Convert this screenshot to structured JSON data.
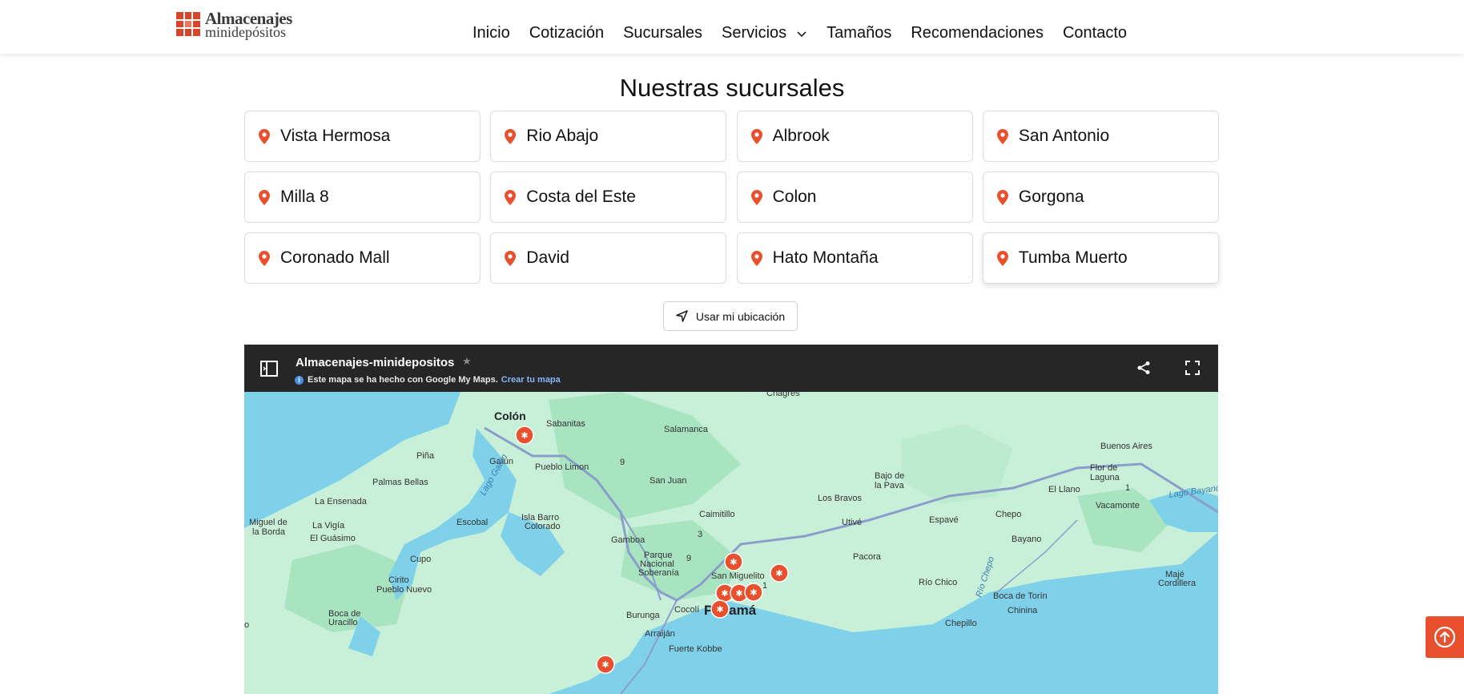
{
  "brand": {
    "line1": "Almacenajes",
    "line2": "minidepósitos"
  },
  "nav": {
    "items": [
      "Inicio",
      "Cotización",
      "Sucursales",
      "Servicios",
      "Tamaños",
      "Recomendaciones",
      "Contacto"
    ]
  },
  "section": {
    "title": "Nuestras sucursales"
  },
  "branches": [
    "Vista Hermosa",
    "Rio Abajo",
    "Albrook",
    "San Antonio",
    "Milla 8",
    "Costa del Este",
    "Colon",
    "Gorgona",
    "Coronado Mall",
    "David",
    "Hato Montaña",
    "Tumba Muerto"
  ],
  "location_button": {
    "label": "Usar mi ubicación"
  },
  "map": {
    "title": "Almacenajes-minidepositos",
    "info_text": "Este mapa se ha hecho con Google My Maps.",
    "create_link": "Crear tu mapa",
    "labels": {
      "colon": "Colón",
      "sabanitas": "Sabanitas",
      "salamanca": "Salamanca",
      "chagres": "Chagres",
      "pina": "Piña",
      "gatun": "Gatún",
      "pueblo_limon": "Pueblo Limon",
      "r9": "9",
      "san_juan": "San Juan",
      "palmas_bellas": "Palmas Bellas",
      "lago_gatun": "Lago Gatún",
      "la_ensenada": "La Ensenada",
      "miguel1": "Miguel de",
      "miguel2": "la Borda",
      "la_vigia": "La Vigía",
      "el_guasimo": "El Guásimo",
      "escobal": "Escobal",
      "isla_barro1": "Isla Barro",
      "isla_barro2": "Colorado",
      "caimitillo": "Caimitillo",
      "r3": "3",
      "gamboa": "Gamboa",
      "parque1": "Parque",
      "parque2": "Nacional",
      "parque3": "Soberanía",
      "r9b": "9",
      "cupo": "Cupo",
      "cirito": "Cirito",
      "pueblo_nuevo": "Pueblo Nuevo",
      "boca1": "Boca de",
      "boca2": "Uracillo",
      "burunga": "Burunga",
      "arraijan": "Arraiján",
      "fuerte_kobbe": "Fuerte Kobbe",
      "cocoli": "Cocolí",
      "panama": "Panamá",
      "san_miguelito": "San Miguelito",
      "r1": "1",
      "los_bravos": "Los Bravos",
      "bajo1": "Bajo de",
      "bajo2": "la Pava",
      "utive": "Utivé",
      "espave": "Espavé",
      "pacora": "Pacora",
      "chepo": "Chepo",
      "el_llano": "El Llano",
      "r1b": "1",
      "buenos_aires": "Buenos Aires",
      "flor1": "Flor de",
      "flor2": "Laguna",
      "lago_bayano": "Lago Bayano",
      "vacamonte": "Vacamonte",
      "bayano": "Bayano",
      "rio_chico": "Río Chico",
      "rio_chepo": "Río Chepo",
      "boca_torin": "Boca de Torín",
      "chinina": "Chinina",
      "chepillo": "Chepillo",
      "maje1": "Majé",
      "maje2": "Cordillera",
      "o_label": "o"
    }
  },
  "colors": {
    "accent": "#e8502e",
    "pin": "#e8502e",
    "map_bar": "#262626",
    "land": "#c8f0d8",
    "water": "#7fd1ea"
  },
  "icons": [
    "map-pin-icon",
    "chevron-down-icon",
    "navigation-arrow-icon",
    "sidebar-toggle-icon",
    "share-icon",
    "fullscreen-icon",
    "arrow-up-circle-icon",
    "storage-marker-icon"
  ]
}
